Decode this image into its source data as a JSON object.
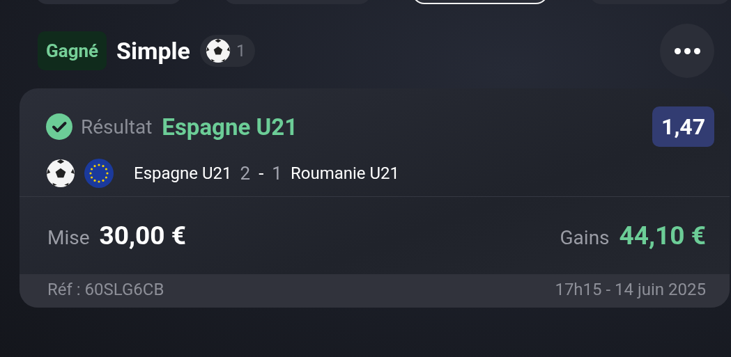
{
  "filter_chips": [
    {
      "selected": false
    },
    {
      "selected": false
    },
    {
      "selected": true
    },
    {
      "selected": false
    }
  ],
  "header": {
    "status": "Gagné",
    "won": true,
    "bet_type": "Simple",
    "selections_count": "1"
  },
  "bet": {
    "settled": true,
    "market": "Résultat",
    "pick": "Espagne U21",
    "odds": "1,47",
    "home": "Espagne U21",
    "home_score": "2",
    "separator": "-",
    "away_score": "1",
    "away": "Roumanie U21"
  },
  "stake": {
    "label": "Mise",
    "value": "30,00 €"
  },
  "winnings": {
    "label": "Gains",
    "value": "44,10 €"
  },
  "footer": {
    "reference": "Réf : 60SLG6CB",
    "datetime": "17h15 - 14 juin 2025"
  }
}
